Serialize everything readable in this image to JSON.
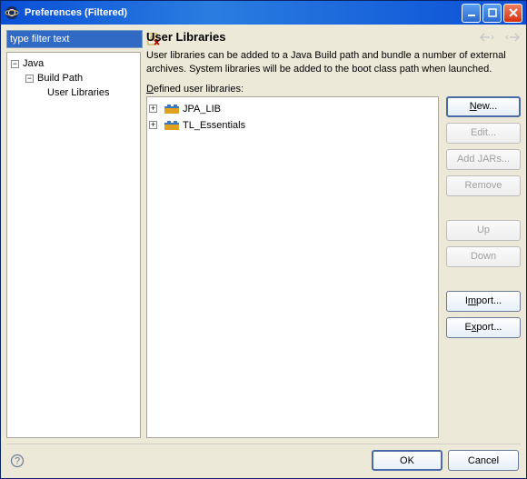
{
  "window": {
    "title": "Preferences (Filtered)"
  },
  "filter": {
    "text": "type filter text"
  },
  "tree": {
    "nodes": [
      {
        "label": "Java",
        "indent": 0,
        "expanded": true
      },
      {
        "label": "Build Path",
        "indent": 1,
        "expanded": true
      },
      {
        "label": "User Libraries",
        "indent": 2,
        "expanded": false
      }
    ]
  },
  "section": {
    "title": "User Libraries",
    "description": "User libraries can be added to a Java Build path and bundle a number of external archives. System libraries will be added to the boot class path when launched.",
    "list_label": "Defined user libraries:"
  },
  "libraries": [
    {
      "name": "JPA_LIB"
    },
    {
      "name": "TL_Essentials"
    }
  ],
  "buttons": {
    "new": "New...",
    "edit": "Edit...",
    "add_jars": "Add JARs...",
    "remove": "Remove",
    "up": "Up",
    "down": "Down",
    "import": "Import...",
    "export": "Export...",
    "ok": "OK",
    "cancel": "Cancel"
  }
}
